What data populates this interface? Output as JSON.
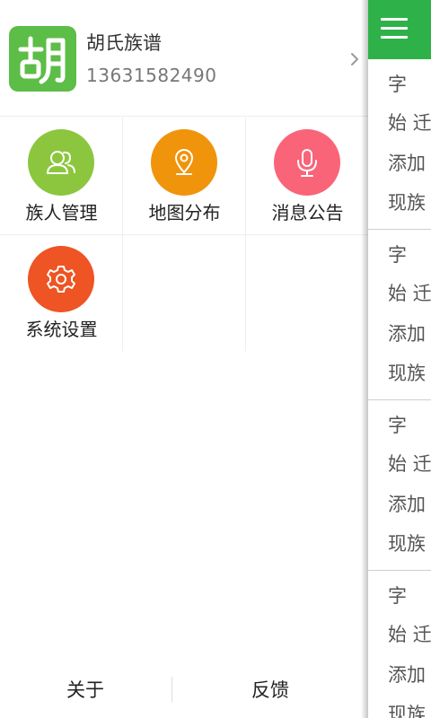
{
  "drawer": {
    "app_name": "胡氏族谱",
    "phone": "13631582490",
    "logo_char": "胡",
    "grid": [
      {
        "label": "族人管理",
        "icon": "people-icon",
        "color": "#8cc63e"
      },
      {
        "label": "地图分布",
        "icon": "location-pin-icon",
        "color": "#f0940c"
      },
      {
        "label": "消息公告",
        "icon": "microphone-icon",
        "color": "#fa6478"
      },
      {
        "label": "系统设置",
        "icon": "gear-icon",
        "color": "#ee5424"
      }
    ],
    "bottom": {
      "about": "关于",
      "feedback": "反馈"
    }
  },
  "main": {
    "topbar_color": "#2fb14a",
    "cards": [
      {
        "line1": "字",
        "line2": "始 迁",
        "line3": "添加",
        "line4": "现族"
      },
      {
        "line1": "字",
        "line2": "始 迁",
        "line3": "添加",
        "line4": "现族"
      },
      {
        "line1": "字",
        "line2": "始 迁",
        "line3": "添加",
        "line4": "现族"
      },
      {
        "line1": "字",
        "line2": "始 迁",
        "line3": "添加",
        "line4": "现族"
      }
    ]
  }
}
